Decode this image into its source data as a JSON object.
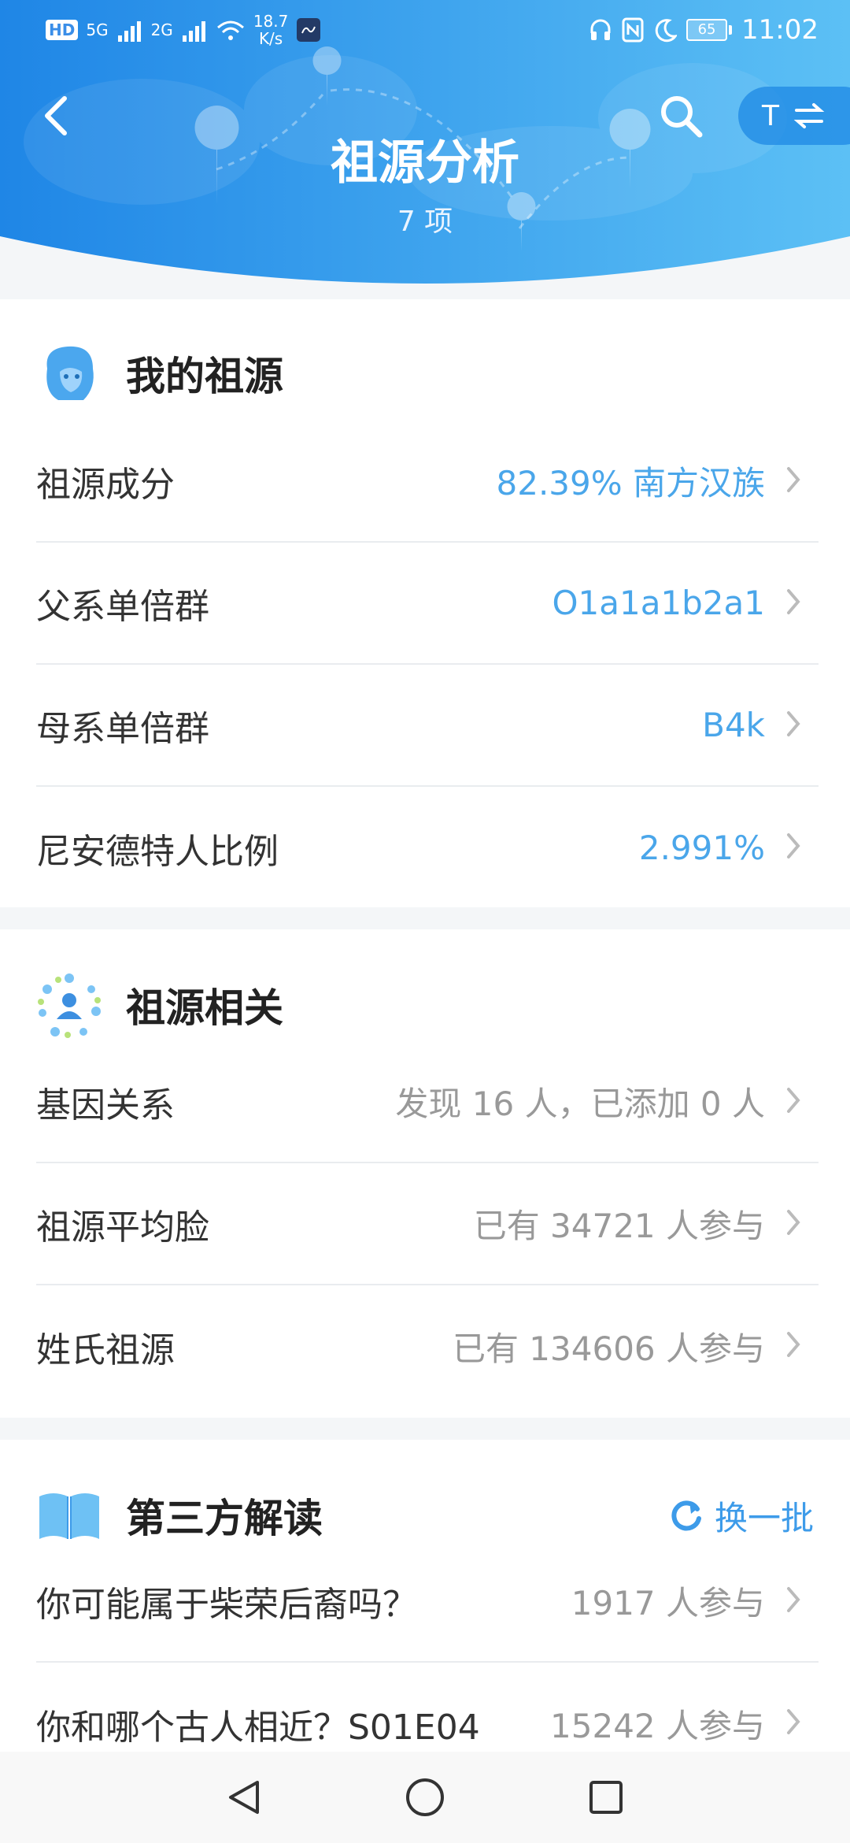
{
  "status_bar": {
    "hd": "HD",
    "sim1": "5G",
    "sim2": "2G",
    "net_speed_value": "18.7",
    "net_speed_unit": "K/s",
    "battery": "65",
    "time": "11:02"
  },
  "header": {
    "title": "祖源分析",
    "subtitle": "7 项",
    "switch_label": "T"
  },
  "my_ancestry": {
    "title": "我的祖源",
    "rows": [
      {
        "label": "祖源成分",
        "value": "82.39% 南方汉族"
      },
      {
        "label": "父系单倍群",
        "value": "O1a1a1b2a1"
      },
      {
        "label": "母系单倍群",
        "value": "B4k"
      },
      {
        "label": "尼安德特人比例",
        "value": "2.991%"
      }
    ]
  },
  "related": {
    "title": "祖源相关",
    "rows": [
      {
        "label": "基因关系",
        "value": "发现 16 人，已添加 0 人"
      },
      {
        "label": "祖源平均脸",
        "value": "已有 34721 人参与"
      },
      {
        "label": "姓氏祖源",
        "value": "已有 134606 人参与"
      }
    ]
  },
  "third_party": {
    "title": "第三方解读",
    "refresh_label": "换一批",
    "rows": [
      {
        "label": "你可能属于柴荣后裔吗？",
        "value": "1917 人参与"
      },
      {
        "label": "你和哪个古人相近？S01E04",
        "value": "15242 人参与"
      }
    ]
  },
  "colors": {
    "header_gradient_left": "#1f86e6",
    "header_gradient_right": "#5cc0f5",
    "accent_value": "#4aa6ea",
    "muted_value": "#999999"
  }
}
